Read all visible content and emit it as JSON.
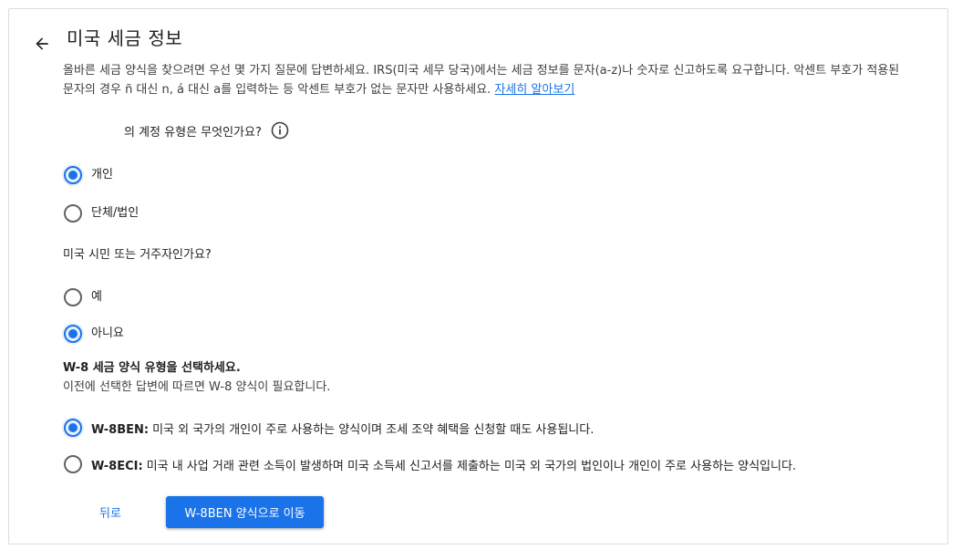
{
  "header": {
    "back_icon": "arrow-left-icon",
    "title": "미국 세금 정보"
  },
  "intro": {
    "text": "올바른 세금 양식을 찾으려면 우선 몇 가지 질문에 답변하세요. IRS(미국 세무 당국)에서는 세금 정보를 문자(a-z)나 숫자로 신고하도록 요구합니다. 악센트 부호가 적용된 문자의 경우 ñ 대신 n, á 대신 a를 입력하는 등 악센트 부호가 없는 문자만 사용하세요. ",
    "link": "자세히 알아보기"
  },
  "account_type": {
    "question": "의 계정 유형은 무엇인가요?",
    "info_icon": "info-icon",
    "options": [
      {
        "label": "개인",
        "checked": true
      },
      {
        "label": "단체/법인",
        "checked": false
      }
    ]
  },
  "citizenship": {
    "question": "미국 시민 또는 거주자인가요?",
    "options": [
      {
        "label": "예",
        "checked": false
      },
      {
        "label": "아니요",
        "checked": true
      }
    ]
  },
  "w8": {
    "title": "W-8 세금 양식 유형을 선택하세요.",
    "subtitle": "이전에 선택한 답변에 따르면 W-8 양식이 필요합니다.",
    "options": [
      {
        "code": "W-8BEN:",
        "description": "미국 외 국가의 개인이 주로 사용하는 양식이며 조세 조약 혜택을 신청할 때도 사용됩니다.",
        "checked": true
      },
      {
        "code": "W-8ECI:",
        "description": "미국 내 사업 거래 관련 소득이 발생하며 미국 소득세 신고서를 제출하는 미국 외 국가의 법인이나 개인이 주로 사용하는 양식입니다.",
        "checked": false
      }
    ]
  },
  "actions": {
    "back_label": "뒤로",
    "primary_label": "W-8BEN 양식으로 이동"
  },
  "colors": {
    "accent": "#1a73e8",
    "border": "#dadce0",
    "text": "#202124"
  }
}
